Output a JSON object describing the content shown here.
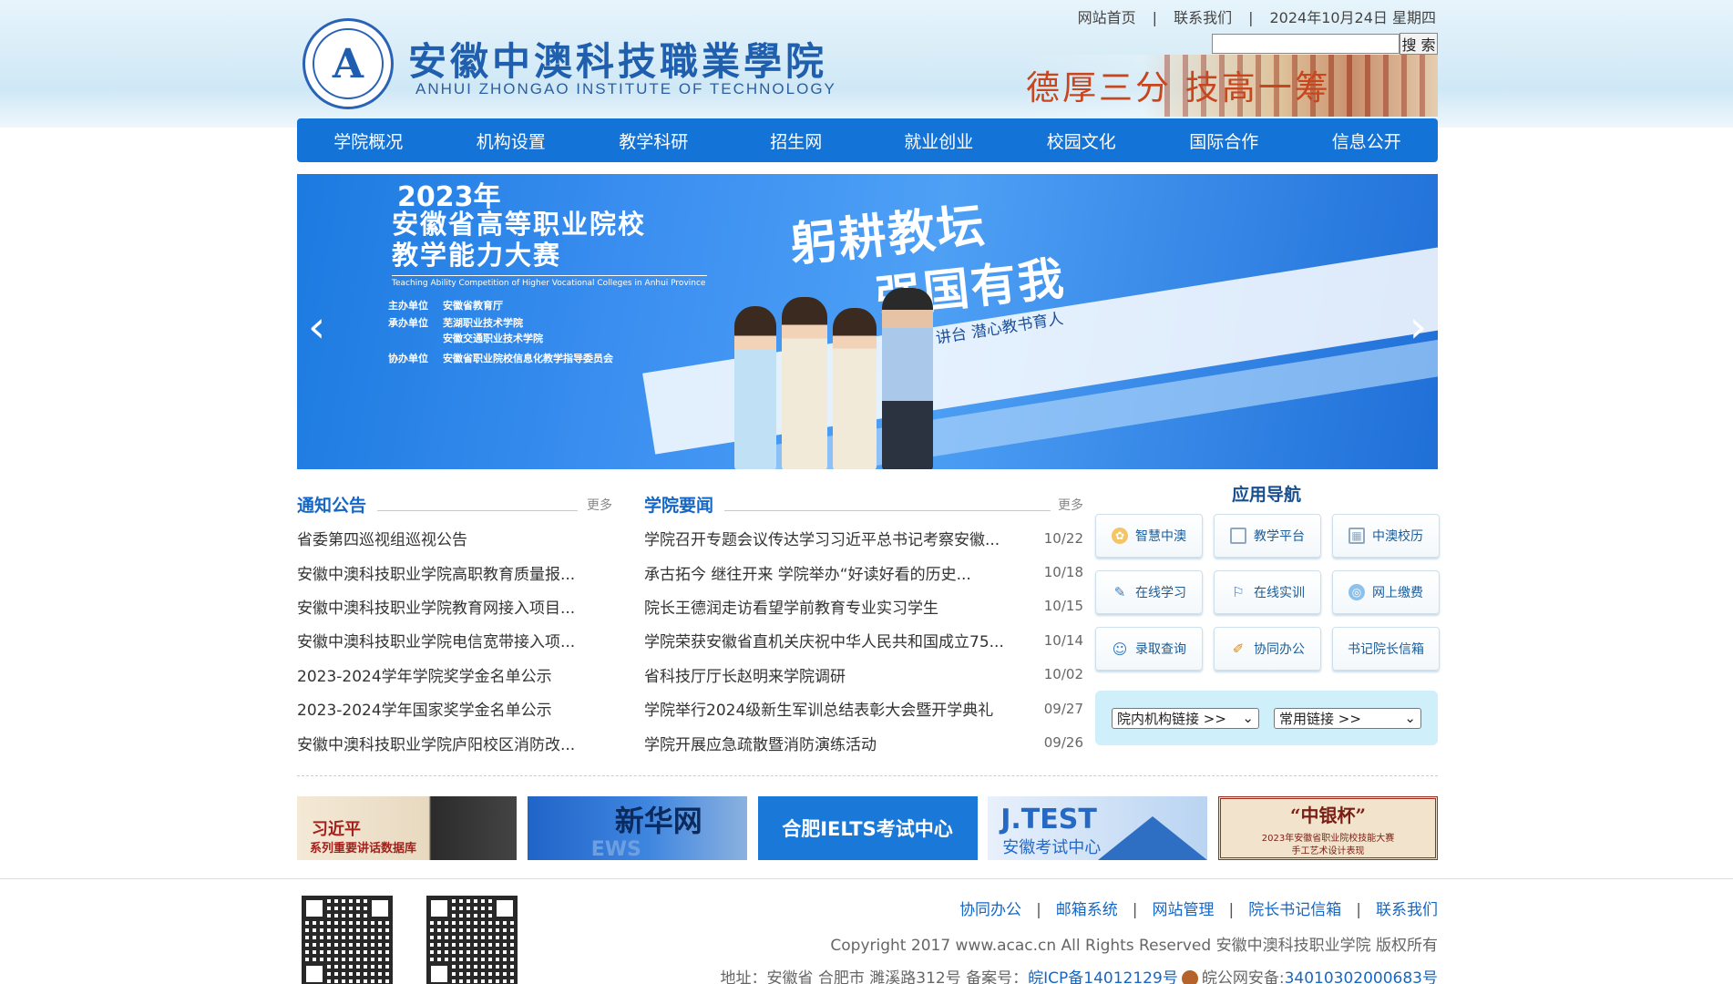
{
  "header": {
    "logo_cn": "安徽中澳科技職業學院",
    "logo_en": "ANHUI ZHONGAO INSTITUTE OF TECHNOLOGY",
    "logo_mark": "A",
    "top_links": [
      "网站首页",
      "联系我们"
    ],
    "date": "2024年10月24日 星期四",
    "search_button": "搜 索",
    "search_value": "",
    "motto": "德厚三分  技高一筹"
  },
  "nav": [
    "学院概况",
    "机构设置",
    "教学科研",
    "招生网",
    "就业创业",
    "校园文化",
    "国际合作",
    "信息公开"
  ],
  "banner": {
    "year": "2023年",
    "line1": "安徽省高等职业院校",
    "line2": "教学能力大赛",
    "en": "Teaching Ability Competition of Higher Vocational Colleges in Anhui Province",
    "rows": [
      {
        "k": "主办单位",
        "v": "安徽省教育厅"
      },
      {
        "k": "承办单位",
        "v": "芜湖职业技术学院"
      },
      {
        "k": "",
        "v": "安徽交通职业技术学院"
      },
      {
        "k": "协办单位",
        "v": "安徽省职业院校信息化教学指导委员会"
      }
    ],
    "slogan1": "躬耕教坛",
    "slogan2": "强国有我",
    "slogan3": "讲台  潜心教书育人",
    "prev": "‹",
    "next": "›"
  },
  "notice": {
    "title": "通知公告",
    "more": "更多",
    "items": [
      "省委第四巡视组巡视公告",
      "安徽中澳科技职业学院高职教育质量报...",
      "安徽中澳科技职业学院教育网接入项目...",
      "安徽中澳科技职业学院电信宽带接入项...",
      "2023-2024学年学院奖学金名单公示",
      "2023-2024学年国家奖学金名单公示",
      "安徽中澳科技职业学院庐阳校区消防改..."
    ]
  },
  "news": {
    "title": "学院要闻",
    "more": "更多",
    "items": [
      {
        "t": "学院召开专题会议传达学习习近平总书记考察安徽...",
        "d": "10/22"
      },
      {
        "t": "承古拓今 继往开来 学院举办“好读好看的历史...",
        "d": "10/18"
      },
      {
        "t": "院长王德润走访看望学前教育专业实习学生",
        "d": "10/15"
      },
      {
        "t": "学院荣获安徽省直机关庆祝中华人民共和国成立75...",
        "d": "10/14"
      },
      {
        "t": "省科技厅厅长赵明来学院调研",
        "d": "10/02"
      },
      {
        "t": "学院举行2024级新生军训总结表彰大会暨开学典礼",
        "d": "09/27"
      },
      {
        "t": "学院开展应急疏散暨消防演练活动",
        "d": "09/26"
      }
    ]
  },
  "apps": {
    "title": "应用导航",
    "items": [
      {
        "label": "智慧中澳",
        "icon": "badge-icon",
        "color": "#e2a340"
      },
      {
        "label": "教学平台",
        "icon": "screen-icon",
        "color": "#6f8fb0"
      },
      {
        "label": "中澳校历",
        "icon": "calendar-icon",
        "color": "#6f8fb0"
      },
      {
        "label": "在线学习",
        "icon": "edit-icon",
        "color": "#3a7cc4"
      },
      {
        "label": "在线实训",
        "icon": "tag-icon",
        "color": "#3a7cc4"
      },
      {
        "label": "网上缴费",
        "icon": "globe-icon",
        "color": "#3a7cc4"
      },
      {
        "label": "录取查询",
        "icon": "user-icon",
        "color": "#3a7cc4"
      },
      {
        "label": "协同办公",
        "icon": "note-icon",
        "color": "#d08a2a"
      },
      {
        "label": "书记院长信箱",
        "icon": "",
        "color": ""
      }
    ],
    "select1": "院内机构链接 >>",
    "select2": "常用链接 >>"
  },
  "link_banners": {
    "xi_title": "习近平",
    "xi_sub": "系列重要讲话数据库",
    "xinhua": "新华网",
    "xinhua_sub": "EWS",
    "ielts": "合肥IELTS考试中心",
    "jtest": "J.TEST",
    "jtest_sub": "安徽考试中心",
    "zyb_title": "“中银杯”",
    "zyb_l1": "2023年安徽省职业院校技能大赛",
    "zyb_l2": "手工艺术设计表现"
  },
  "footer": {
    "links": [
      "协同办公",
      "邮箱系统",
      "网站管理",
      "院长书记信箱",
      "联系我们"
    ],
    "copyright": "Copyright 2017 www.acac.cn All Rights Reserved 安徽中澳科技职业学院 版权所有",
    "address_prefix": "地址：安徽省 合肥市 濉溪路312号 备案号：",
    "icp": "皖ICP备14012129号",
    "police_prefix": "皖公网安备:",
    "police_no": "34010302000683号"
  },
  "colors": {
    "primary": "#1473d6",
    "title": "#1467c7"
  }
}
